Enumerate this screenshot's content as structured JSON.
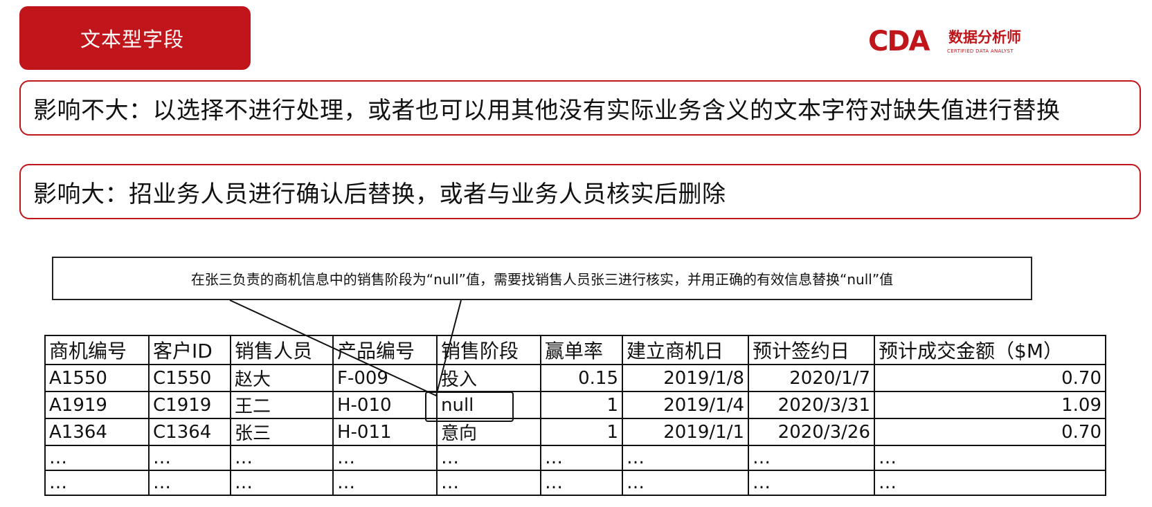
{
  "title": "文本型字段",
  "logo": {
    "mark": "CDA",
    "cn": "数据分析师",
    "en": "CERTIFIED DATA ANALYST"
  },
  "points": [
    "影响不大：以选择不进行处理，或者也可以用其他没有实际业务含义的文本字符对缺失值进行替换",
    "影响大：招业务人员进行确认后替换，或者与业务人员核实后删除"
  ],
  "callout": "在张三负责的商机信息中的销售阶段为“null”值，需要找销售人员张三进行核实，并用正确的有效信息替换“null”值",
  "table": {
    "headers": [
      "商机编号",
      "客户ID",
      "销售人员",
      "产品编号",
      "销售阶段",
      "赢单率",
      "建立商机日",
      "预计签约日",
      "预计成交金额（$M）"
    ],
    "rows": [
      [
        "A1550",
        "C1550",
        "赵大",
        "F-009",
        "投入",
        "0.15",
        "2019/1/8",
        "2020/1/7",
        "0.70"
      ],
      [
        "A1919",
        "C1919",
        "王二",
        "H-010",
        "null",
        "1",
        "2019/1/4",
        "2020/3/31",
        "1.09"
      ],
      [
        "A1364",
        "C1364",
        "张三",
        "H-011",
        "意向",
        "1",
        "2019/1/1",
        "2020/3/26",
        "0.70"
      ],
      [
        "…",
        "…",
        "…",
        "…",
        "…",
        "…",
        "…",
        "…",
        "…"
      ],
      [
        "…",
        "…",
        "…",
        "…",
        "…",
        "…",
        "…",
        "…",
        "…"
      ]
    ]
  },
  "colors": {
    "accent": "#c0161b"
  }
}
